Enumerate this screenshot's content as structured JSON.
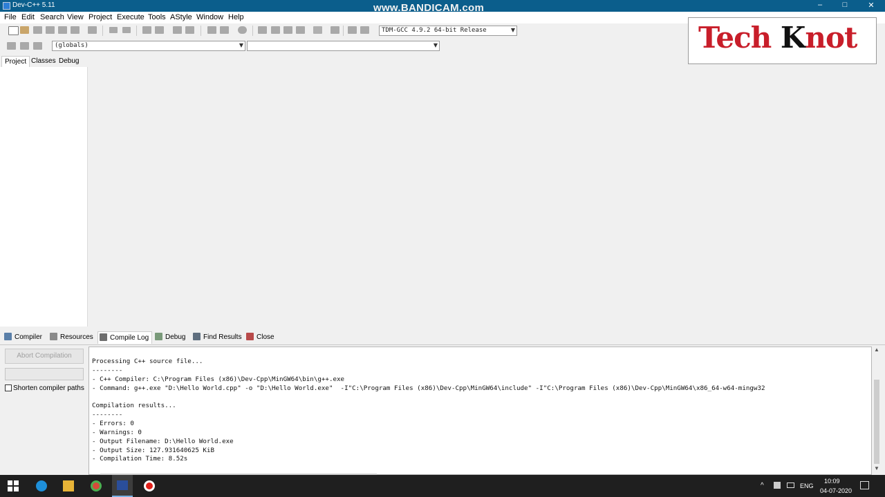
{
  "window": {
    "title": "Dev-C++ 5.11",
    "minimize": "–",
    "maximize": "□",
    "close": "✕"
  },
  "watermark": "www.BANDICAM.com",
  "logo": {
    "text_part1": "Tech ",
    "text_k": "K",
    "text_part2": "not"
  },
  "menu": [
    {
      "label": "File"
    },
    {
      "label": "Edit"
    },
    {
      "label": "Search"
    },
    {
      "label": "View"
    },
    {
      "label": "Project"
    },
    {
      "label": "Execute"
    },
    {
      "label": "Tools"
    },
    {
      "label": "AStyle"
    },
    {
      "label": "Window"
    },
    {
      "label": "Help"
    }
  ],
  "toolbar": {
    "compiler_select": "TDM-GCC 4.9.2 64-bit Release",
    "scope_select": "(globals)",
    "member_select": ""
  },
  "left_tabs": [
    {
      "label": "Project"
    },
    {
      "label": "Classes"
    },
    {
      "label": "Debug"
    }
  ],
  "bottom_tabs": [
    {
      "label": "Compiler"
    },
    {
      "label": "Resources"
    },
    {
      "label": "Compile Log"
    },
    {
      "label": "Debug"
    },
    {
      "label": "Find Results"
    },
    {
      "label": "Close"
    }
  ],
  "compile_panel": {
    "abort_label": "Abort Compilation",
    "shorten_label": "Shorten compiler paths",
    "log_lines": [
      "Processing C++ source file...",
      "--------",
      "- C++ Compiler: C:\\Program Files (x86)\\Dev-Cpp\\MinGW64\\bin\\g++.exe",
      "- Command: g++.exe \"D:\\Hello World.cpp\" -o \"D:\\Hello World.exe\"  -I\"C:\\Program Files (x86)\\Dev-Cpp\\MinGW64\\include\" -I\"C:\\Program Files (x86)\\Dev-Cpp\\MinGW64\\x86_64-w64-mingw32",
      "",
      "Compilation results...",
      "--------",
      "- Errors: 0",
      "- Warnings: 0",
      "- Output Filename: D:\\Hello World.exe",
      "- Output Size: 127.931640625 KiB",
      "- Compilation Time: 8.52s"
    ]
  },
  "taskbar": {
    "lang": "ENG",
    "time": "10:09",
    "date": "04-07-2020"
  }
}
